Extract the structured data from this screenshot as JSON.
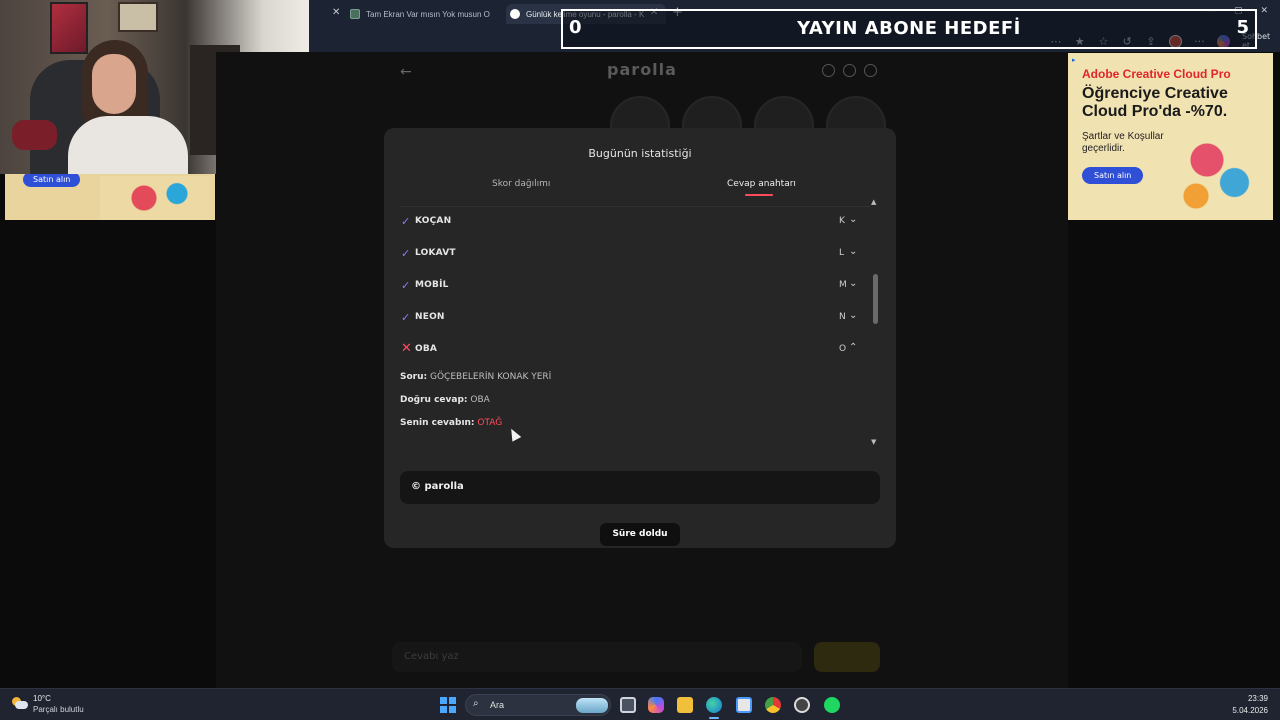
{
  "browser": {
    "tabs": [
      {
        "label": "Tam Ekran Var mısın Yok musun O"
      },
      {
        "label": "Günlük kelime oyunu - parolla - K"
      }
    ],
    "chat_label": "Sohbet et"
  },
  "overlay": {
    "goal_current": "0",
    "goal_title": "YAYIN ABONE HEDEFİ",
    "goal_target": "5"
  },
  "ads": {
    "left_button": "Satın alın",
    "right_brand": "Adobe Creative Cloud Pro",
    "right_headline": "Öğrenciye Creative Cloud Pro'da -%70.",
    "right_terms": "Şartlar ve Koşullar geçerlidir.",
    "right_button": "Satın alın"
  },
  "game": {
    "title": "parolla",
    "back_glyph": "←",
    "input_placeholder": "Cevabı yaz"
  },
  "modal": {
    "title": "Bugünün istatistiği",
    "tabs": [
      {
        "label": "Skor dağılımı",
        "active": false
      },
      {
        "label": "Cevap anahtarı",
        "active": true
      }
    ],
    "answers": [
      {
        "word": "KOÇAN",
        "letter": "K",
        "correct": true,
        "expanded": false
      },
      {
        "word": "LOKAVT",
        "letter": "L",
        "correct": true,
        "expanded": false
      },
      {
        "word": "MOBİL",
        "letter": "M",
        "correct": true,
        "expanded": false
      },
      {
        "word": "NEON",
        "letter": "N",
        "correct": true,
        "expanded": false
      },
      {
        "word": "OBA",
        "letter": "O",
        "correct": false,
        "expanded": true
      }
    ],
    "detail": {
      "question_label": "Soru:",
      "question": "GÖÇEBELERİN KONAK YERİ",
      "correct_label": "Doğru cevap:",
      "correct_answer": "OBA",
      "your_label": "Senin cevabın:",
      "your_answer": "OTAĞ"
    },
    "copyright": "© parolla",
    "status_button": "Süre doldu",
    "accent_color": "#ff4b5c",
    "check_color": "#8b7cf6"
  },
  "taskbar": {
    "weather_temp": "10°C",
    "weather_desc": "Parçalı bulutlu",
    "search_label": "Ara",
    "time": "23:39",
    "date": "5.04.2026"
  }
}
